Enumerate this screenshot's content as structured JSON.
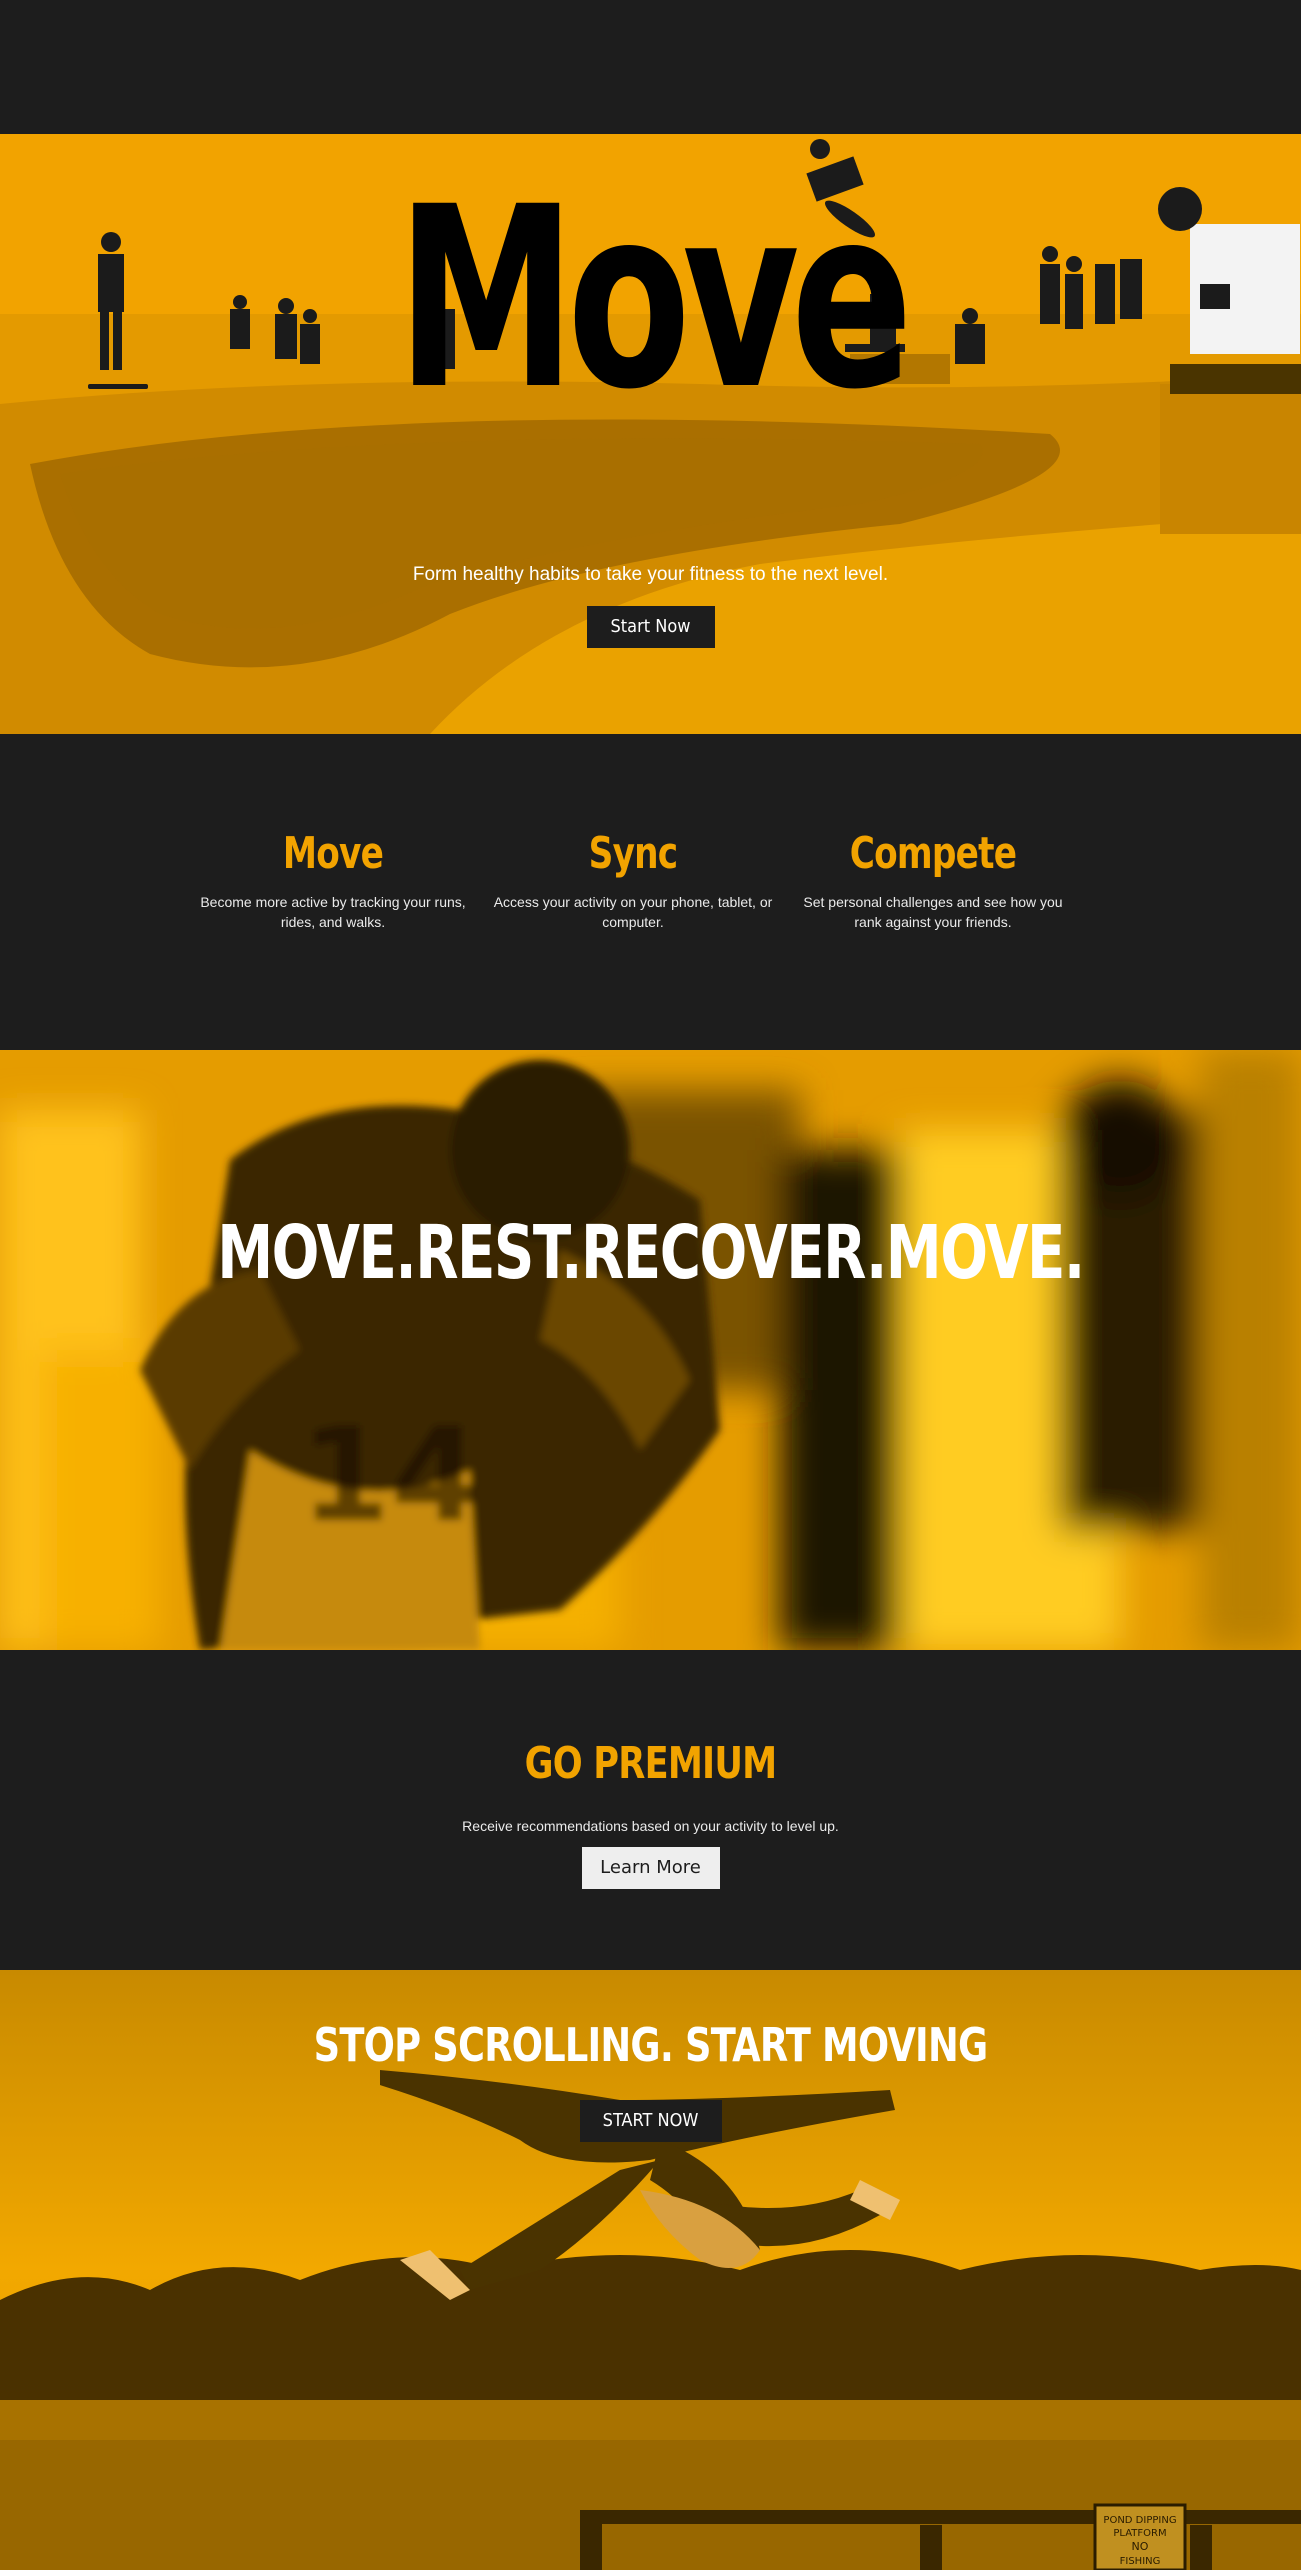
{
  "hero": {
    "title": "Move",
    "tagline": "Form healthy habits to take your fitness to the next level.",
    "cta_label": "Start Now"
  },
  "features": [
    {
      "title": "Move",
      "text": "Become more active by tracking your runs, rides, and walks."
    },
    {
      "title": "Sync",
      "text": "Access your activity on your phone, tablet, or computer."
    },
    {
      "title": "Compete",
      "text": "Set personal challenges and see how you rank against your friends."
    }
  ],
  "banner": {
    "headline": "MOVE.REST.RECOVER.MOVE."
  },
  "premium": {
    "title": "GO PREMIUM",
    "text": "Receive recommendations based on your activity to level up.",
    "cta_label": "Learn More"
  },
  "cta": {
    "headline": "STOP SCROLLING. START MOVING",
    "button_label": "START NOW",
    "sign_text": [
      "POND DIPPING",
      "PLATFORM",
      "NO",
      "FISHING"
    ]
  },
  "colors": {
    "accent": "#f2a300",
    "dark": "#1d1d1d",
    "light": "#eeeeee"
  }
}
